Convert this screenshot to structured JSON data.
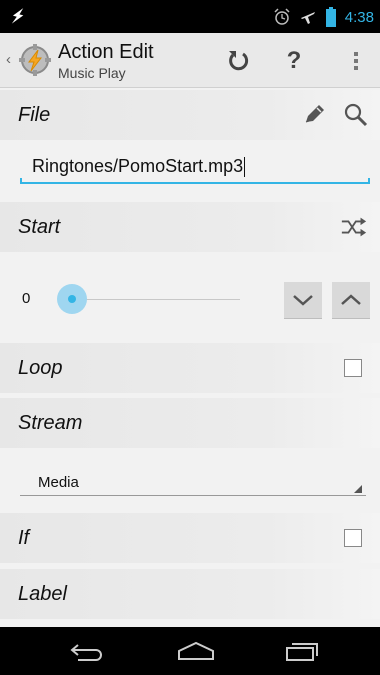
{
  "status_bar": {
    "time": "4:38",
    "left_icon": "lightning-icon",
    "icons": [
      "alarm-icon",
      "airplane-icon",
      "battery-icon"
    ]
  },
  "action_bar": {
    "title": "Action Edit",
    "subtitle": "Music Play",
    "actions": [
      "refresh-icon",
      "help-icon",
      "overflow-menu-icon"
    ],
    "help_label": "?"
  },
  "file": {
    "label": "File",
    "value": "Ringtones/PomoStart.mp3"
  },
  "start": {
    "label": "Start",
    "value": "0",
    "slider_fraction": 0.0
  },
  "loop": {
    "label": "Loop",
    "checked": false
  },
  "stream": {
    "label": "Stream",
    "selected": "Media"
  },
  "if_section": {
    "label": "If",
    "checked": false
  },
  "label_section": {
    "label": "Label"
  },
  "colors": {
    "accent": "#33b5e5",
    "status_bar_bg": "#000000",
    "section_bg": "#e7e7e7"
  },
  "nav": [
    "back-icon",
    "home-icon",
    "recents-icon"
  ]
}
